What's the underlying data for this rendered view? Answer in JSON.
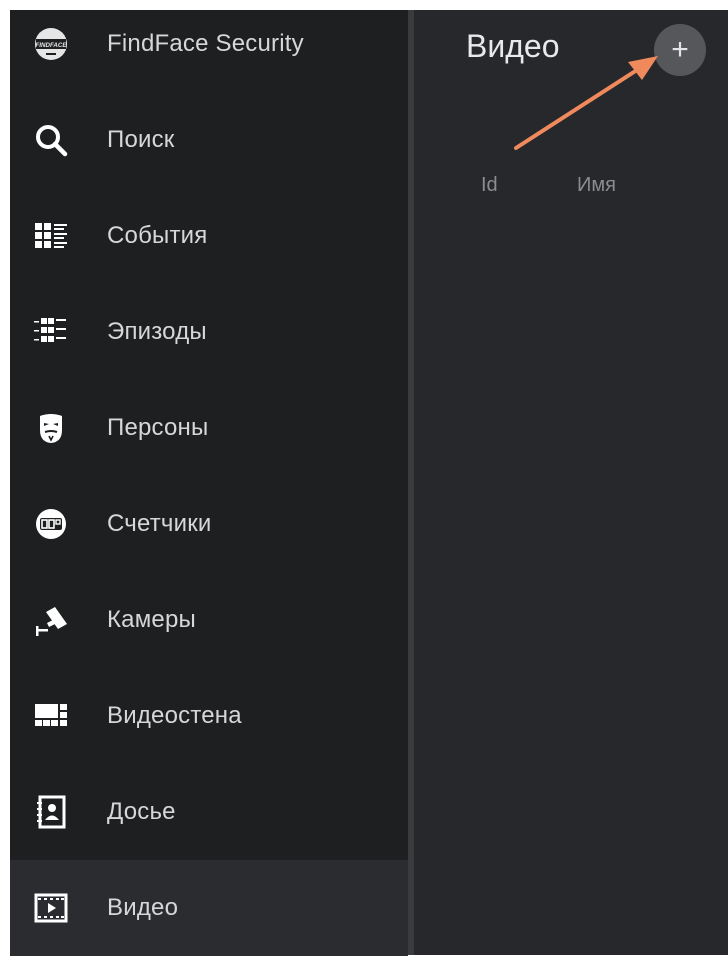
{
  "sidebar": {
    "items": [
      {
        "label": "FindFace Security",
        "icon": "findface-logo-icon",
        "active": false
      },
      {
        "label": "Поиск",
        "icon": "search-icon",
        "active": false
      },
      {
        "label": "События",
        "icon": "events-list-icon",
        "active": false
      },
      {
        "label": "Эпизоды",
        "icon": "episodes-icon",
        "active": false
      },
      {
        "label": "Персоны",
        "icon": "persons-mask-icon",
        "active": false
      },
      {
        "label": "Счетчики",
        "icon": "counter-icon",
        "active": false
      },
      {
        "label": "Камеры",
        "icon": "camera-icon",
        "active": false
      },
      {
        "label": "Видеостена",
        "icon": "videowall-icon",
        "active": false
      },
      {
        "label": "Досье",
        "icon": "dossier-icon",
        "active": false
      },
      {
        "label": "Видео",
        "icon": "video-film-icon",
        "active": true
      }
    ],
    "logo_text": "FINDFACE"
  },
  "main": {
    "title": "Видео",
    "add_button_label": "+",
    "columns": [
      {
        "label": "Id"
      },
      {
        "label": "Имя"
      }
    ]
  },
  "annotation": {
    "icon": "arrow-icon",
    "color": "#f08a5d"
  },
  "colors": {
    "sidebar_bg": "#1e1f21",
    "main_bg": "#26282b",
    "active_item_bg": "#2b2c2f",
    "text": "#d6d7d8",
    "add_button_bg": "#55575b"
  }
}
